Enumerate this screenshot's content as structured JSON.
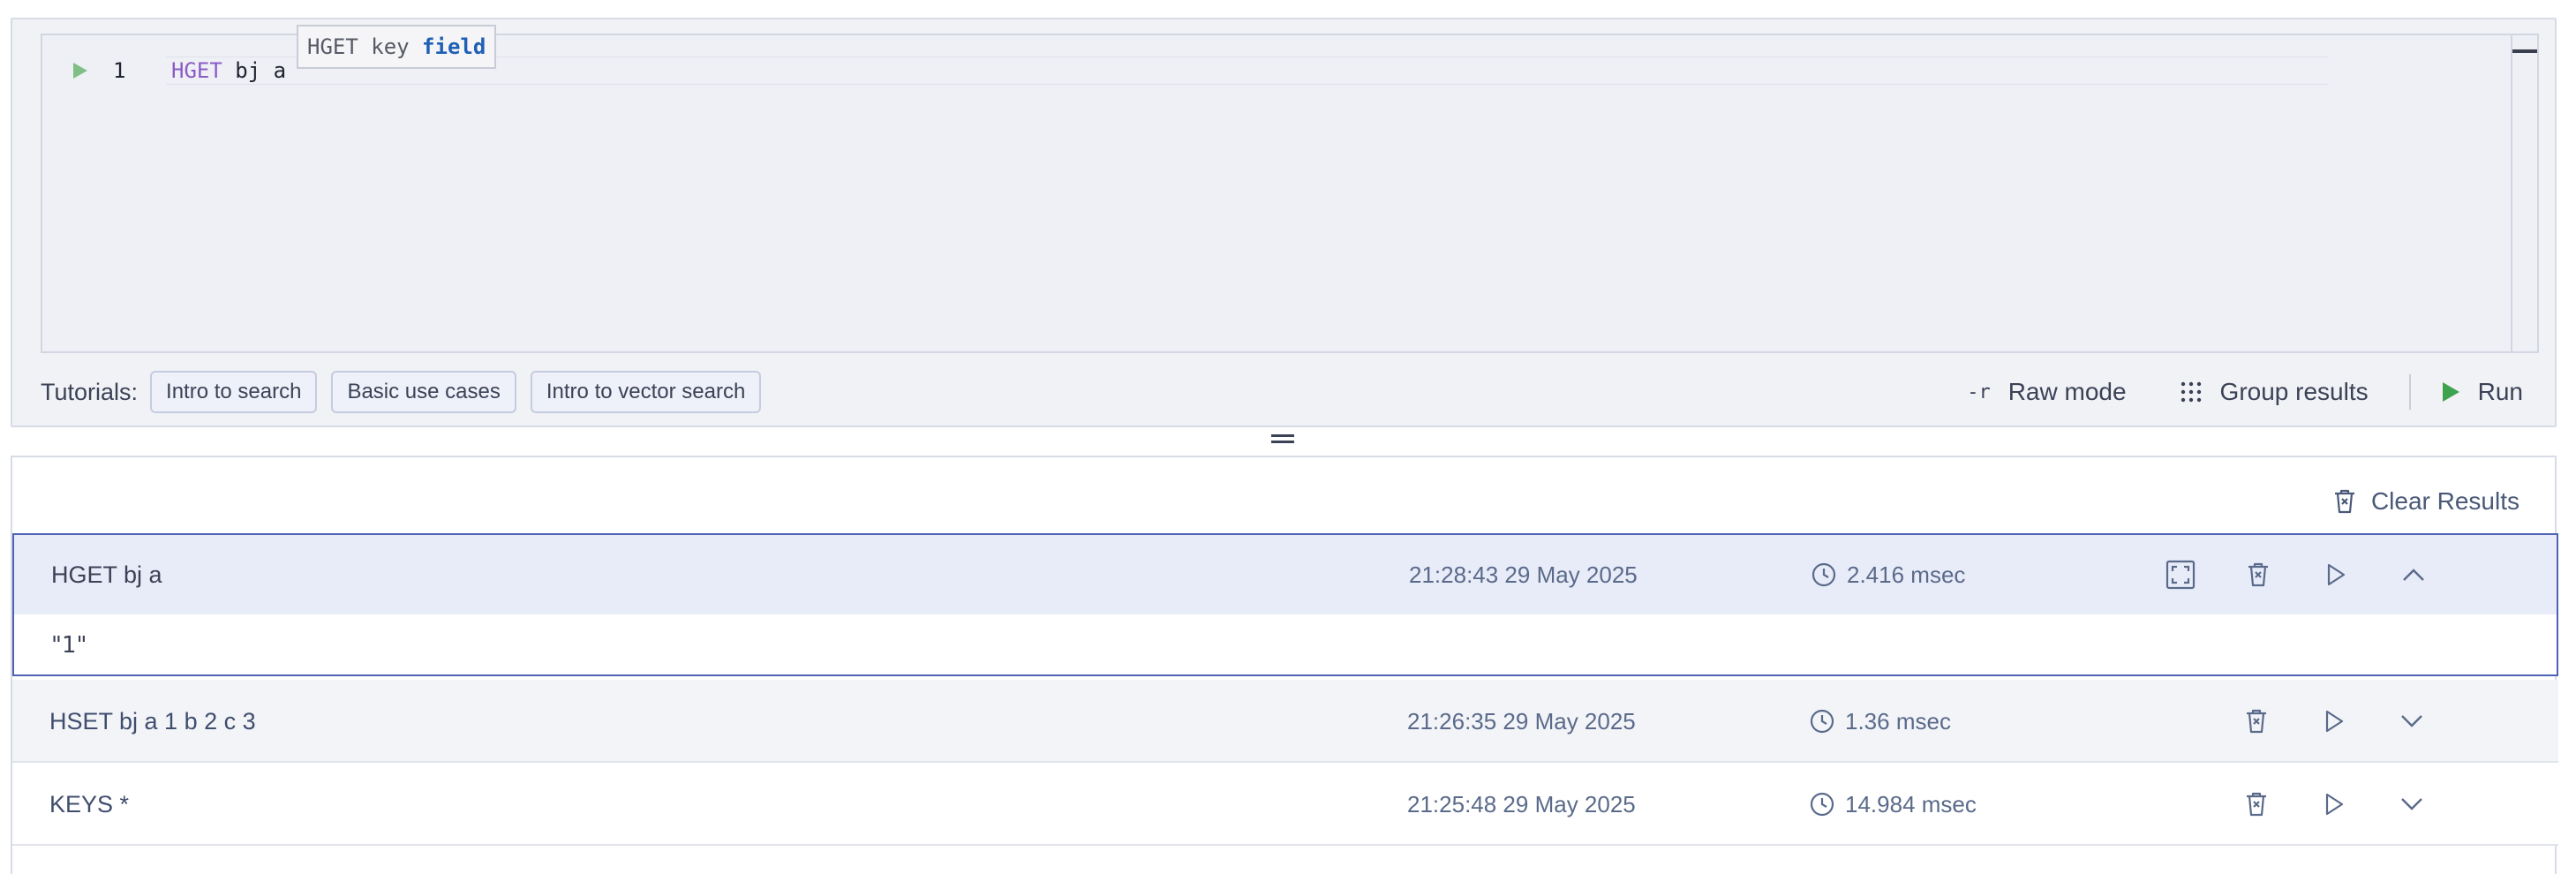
{
  "editor": {
    "line_number": "1",
    "command_keyword": "HGET",
    "command_args": " bj a",
    "hint_prefix": "HGET key ",
    "hint_param": "field"
  },
  "tutorials": {
    "label": "Tutorials:",
    "buttons": [
      "Intro to search",
      "Basic use cases",
      "Intro to vector search"
    ]
  },
  "toolbar": {
    "raw_mode_icon": "-r",
    "raw_mode_label": "Raw mode",
    "group_results_label": "Group results",
    "run_label": "Run"
  },
  "results_header": {
    "clear_label": "Clear Results"
  },
  "results": [
    {
      "command": "HGET bj a",
      "timestamp": "21:28:43 29 May 2025",
      "duration": "2.416 msec",
      "output": "\"1\"",
      "expanded": true
    },
    {
      "command": "HSET bj a 1 b 2 c 3",
      "timestamp": "21:26:35 29 May 2025",
      "duration": "1.36 msec",
      "expanded": false
    },
    {
      "command": "KEYS *",
      "timestamp": "21:25:48 29 May 2025",
      "duration": "14.984 msec",
      "expanded": false
    }
  ],
  "colors": {
    "accent": "#4e63b5",
    "run_green": "#3fa34d",
    "keyword_purple": "#8a5cc6",
    "hint_param_blue": "#1f5fb6"
  },
  "icons": {
    "run_line": "play-icon",
    "raw_mode": "raw-mode-icon",
    "group_results": "grid-dots-icon",
    "run": "play-icon",
    "clear": "trash-icon",
    "duration": "clock-icon",
    "fullscreen": "fullscreen-icon",
    "delete": "trash-icon",
    "rerun": "play-outline-icon",
    "collapse": "chevron-up-icon",
    "expand": "chevron-down-icon"
  }
}
